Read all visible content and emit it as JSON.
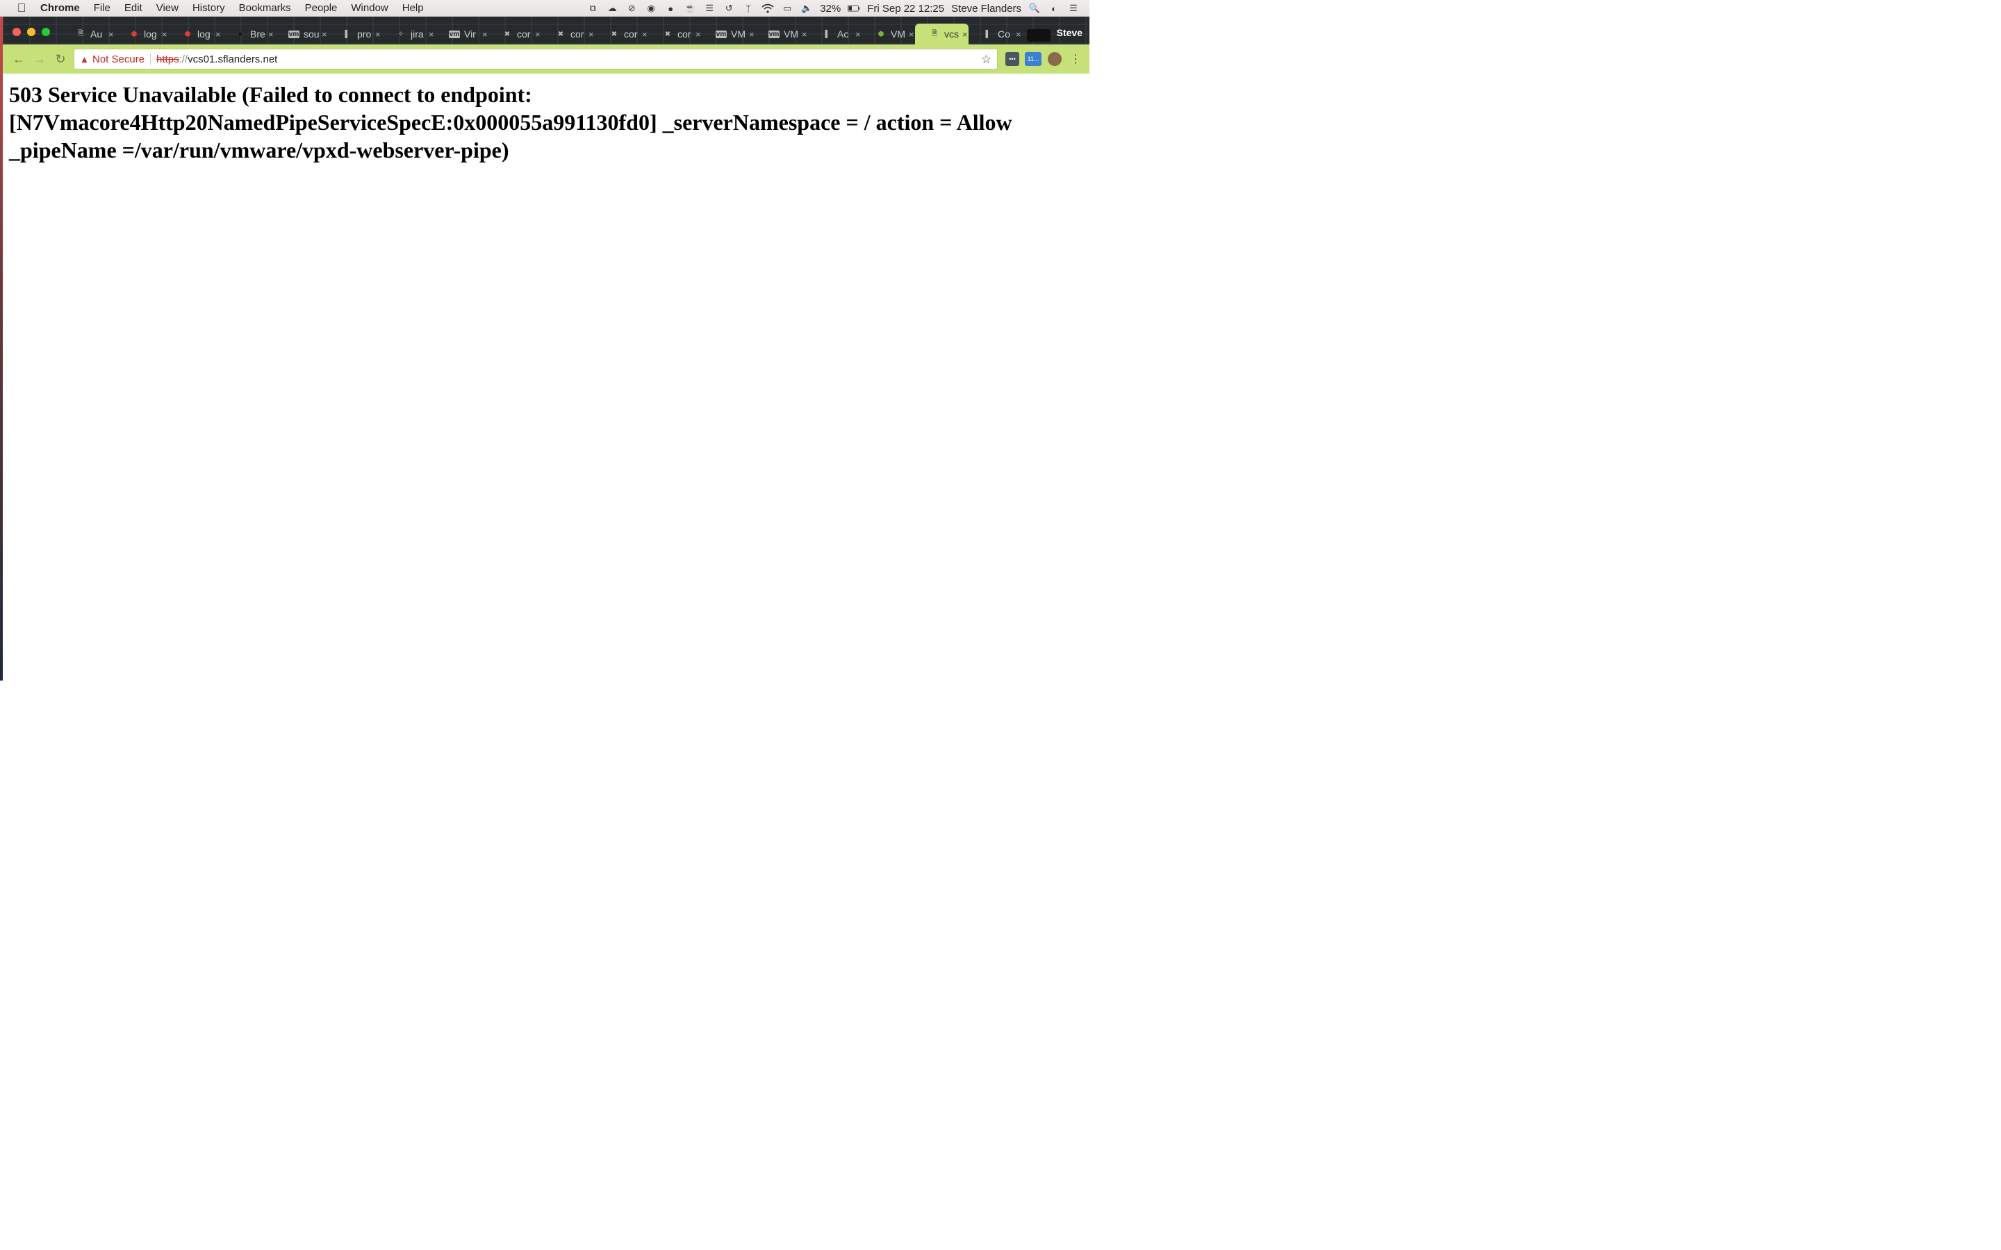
{
  "menubar": {
    "app_name": "Chrome",
    "items": [
      "File",
      "Edit",
      "View",
      "History",
      "Bookmarks",
      "People",
      "Window",
      "Help"
    ],
    "battery": "32%",
    "datetime": "Fri Sep 22  12:25",
    "user": "Steve Flanders"
  },
  "tabs": [
    {
      "label": "Au",
      "icon": "document-icon"
    },
    {
      "label": "log",
      "icon": "hexagon-icon"
    },
    {
      "label": "log",
      "icon": "hexagon-icon"
    },
    {
      "label": "Bre",
      "icon": "dark-circle-icon"
    },
    {
      "label": "sou",
      "icon": "vm-icon"
    },
    {
      "label": "pro",
      "icon": "bar-chart-icon"
    },
    {
      "label": "jira",
      "icon": "jira-icon"
    },
    {
      "label": "Vir",
      "icon": "vm-icon"
    },
    {
      "label": "cor",
      "icon": "tools-icon"
    },
    {
      "label": "cor",
      "icon": "tools-icon"
    },
    {
      "label": "cor",
      "icon": "tools-icon"
    },
    {
      "label": "cor",
      "icon": "tools-icon"
    },
    {
      "label": "VM",
      "icon": "vm-icon"
    },
    {
      "label": "VM",
      "icon": "vm-icon"
    },
    {
      "label": "Ac",
      "icon": "bar-chart-icon"
    },
    {
      "label": "VM",
      "icon": "hexagon-color-icon"
    },
    {
      "label": "vcs",
      "icon": "document-icon",
      "active": true
    },
    {
      "label": "Co",
      "icon": "bar-chart-icon"
    }
  ],
  "profile_name": "Steve",
  "omnibox": {
    "security_label": "Not Secure",
    "scheme": "https",
    "separator": "://",
    "host": "vcs01.sflanders.net"
  },
  "extensions": {
    "badge": "11..."
  },
  "page": {
    "heading": "503 Service Unavailable (Failed to connect to endpoint: [N7Vmacore4Http20NamedPipeServiceSpecE:0x000055a991130fd0] _serverNamespace = / action = Allow _pipeName =/var/run/vmware/vpxd-webserver-pipe)"
  },
  "colors": {
    "theme": "#c6e07a",
    "tabstrip": "#262a2d",
    "insecure": "#c62828"
  }
}
